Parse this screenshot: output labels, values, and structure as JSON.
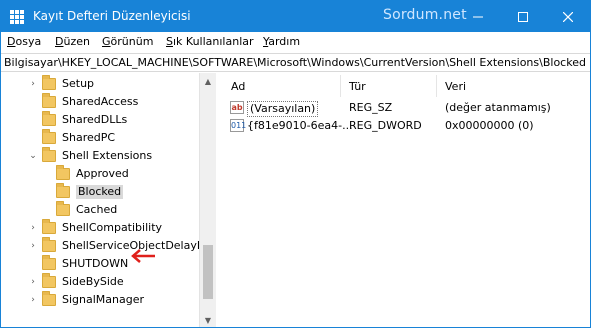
{
  "window": {
    "title": "Kayıt Defteri Düzenleyicisi",
    "watermark": "Sordum.net",
    "accent": "#1883d7"
  },
  "titlebar_buttons": {
    "minimize_icon": "minimize-icon",
    "maximize_icon": "maximize-icon",
    "close_icon": "close-icon"
  },
  "menu": [
    {
      "acc": "D",
      "rest": "osya"
    },
    {
      "acc": "D",
      "rest": "üzen"
    },
    {
      "acc": "G",
      "rest": "örünüm"
    },
    {
      "acc": "S",
      "rest": "ık Kullanılanlar"
    },
    {
      "acc": "Y",
      "rest": "ardım"
    }
  ],
  "address": "Bilgisayar\\HKEY_LOCAL_MACHINE\\SOFTWARE\\Microsoft\\Windows\\CurrentVersion\\Shell Extensions\\Blocked",
  "tree": [
    {
      "label": "Setup",
      "chevron": "›"
    },
    {
      "label": "SharedAccess",
      "chevron": ""
    },
    {
      "label": "SharedDLLs",
      "chevron": ""
    },
    {
      "label": "SharedPC",
      "chevron": ""
    },
    {
      "label": "Shell Extensions",
      "chevron": "⌄"
    },
    {
      "label": "Approved",
      "chevron": ""
    },
    {
      "label": "Blocked",
      "chevron": ""
    },
    {
      "label": "Cached",
      "chevron": ""
    },
    {
      "label": "ShellCompatibility",
      "chevron": "›"
    },
    {
      "label": "ShellServiceObjectDelayLo",
      "chevron": "›"
    },
    {
      "label": "SHUTDOWN",
      "chevron": ""
    },
    {
      "label": "SideBySide",
      "chevron": "›"
    },
    {
      "label": "SignalManager",
      "chevron": "›"
    }
  ],
  "selected_tree_item": "Blocked",
  "list": {
    "headers": {
      "name": "Ad",
      "type": "Tür",
      "data": "Veri"
    },
    "rows": [
      {
        "icon": "ab",
        "name": "(Varsayılan)",
        "type": "REG_SZ",
        "data": "(değer atanmamış)"
      },
      {
        "icon": "011",
        "name": "{f81e9010-6ea4-...",
        "type": "REG_DWORD",
        "data": "0x00000000 (0)"
      }
    ]
  },
  "annotation_color": "#e0201b"
}
